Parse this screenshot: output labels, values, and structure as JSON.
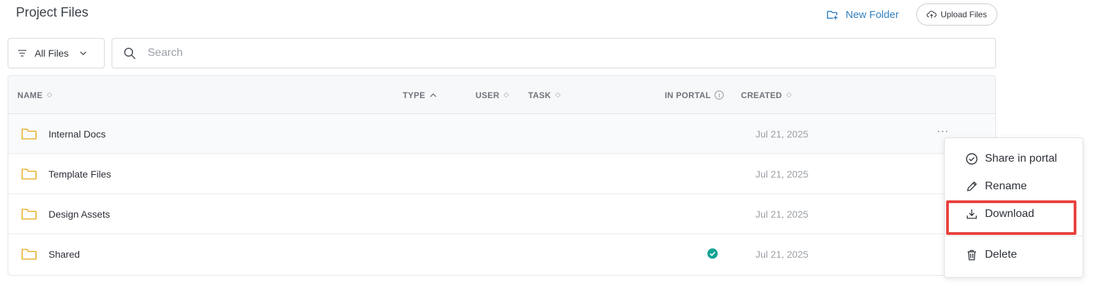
{
  "header": {
    "title": "Project Files",
    "new_folder_label": "New Folder",
    "upload_label": "Upload Files"
  },
  "toolbar": {
    "filter_value": "All Files",
    "search_placeholder": "Search",
    "search_value": ""
  },
  "table": {
    "columns": [
      {
        "label": "NAME",
        "sort": "unsorted"
      },
      {
        "label": "TYPE",
        "sort": "ascending"
      },
      {
        "label": "USER",
        "sort": "unsorted"
      },
      {
        "label": "TASK",
        "sort": "unsorted"
      },
      {
        "label": "IN PORTAL",
        "info": true
      },
      {
        "label": "CREATED",
        "sort": "unsorted"
      }
    ],
    "rows": [
      {
        "name": "Internal Docs",
        "type": "folder",
        "in_portal": false,
        "created": "Jul 21, 2025"
      },
      {
        "name": "Template Files",
        "type": "folder",
        "in_portal": false,
        "created": "Jul 21, 2025"
      },
      {
        "name": "Design Assets",
        "type": "folder",
        "in_portal": false,
        "created": "Jul 21, 2025"
      },
      {
        "name": "Shared",
        "type": "folder",
        "in_portal": true,
        "created": "Jul 21, 2025"
      }
    ],
    "row_actions_glyph": "···"
  },
  "context_menu": {
    "items": [
      {
        "label": "Share in portal",
        "icon": "check-circle-icon"
      },
      {
        "label": "Rename",
        "icon": "pencil-icon"
      },
      {
        "label": "Download",
        "icon": "download-icon",
        "highlighted": true
      },
      {
        "label": "Delete",
        "icon": "trash-icon"
      }
    ]
  },
  "colors": {
    "accent": "#2f7fbf",
    "folder": "#e6b32e",
    "portal_check": "#14a394",
    "highlight": "#e8433e"
  }
}
